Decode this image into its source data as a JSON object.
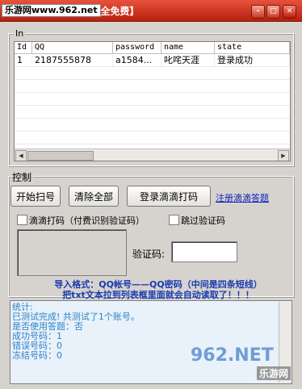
{
  "window": {
    "watermark": "乐游网www.962.net",
    "title": "...-V2.1版【完全免费】",
    "min_label": "-",
    "max_label": "□",
    "close_label": "✕"
  },
  "list_group": {
    "legend": "In",
    "columns": [
      "Id",
      "QQ",
      "password",
      "name",
      "state"
    ],
    "rows": [
      {
        "id": "1",
        "qq": "2187555878",
        "password": "a1584...",
        "name": "叱咤天涯",
        "state": "登录成功"
      }
    ]
  },
  "control_group": {
    "legend": "控制",
    "start_button": "开始扫号",
    "clear_button": "清除全部",
    "login_button": "登录滴滴打码",
    "register_link": "注册滴滴答题",
    "checkbox_didi": "滴滴打码（付费识别验证码）",
    "checkbox_skip": "跳过验证码",
    "captcha_label": "验证码:",
    "captcha_value": ""
  },
  "hints": {
    "line1": "导入格式：QQ帐号——QQ密码（中间是四条短线）",
    "line2": "把txt文本拉到列表框里面就会自动读取了！！！"
  },
  "log": {
    "lines": [
      "统计:",
      "已测试完成! 共测试了1个账号。",
      "是否使用答题：否",
      "成功号码：1",
      "错误号码：0",
      "冻结号码：0"
    ]
  },
  "site_brand": {
    "logo_text": "962.NET",
    "logo_sub": "乐游网"
  },
  "colors": {
    "title_bar": "#c52c15",
    "hint_text": "#1a3bb0",
    "log_text": "#2d84c4",
    "link": "#0a1cbd"
  }
}
